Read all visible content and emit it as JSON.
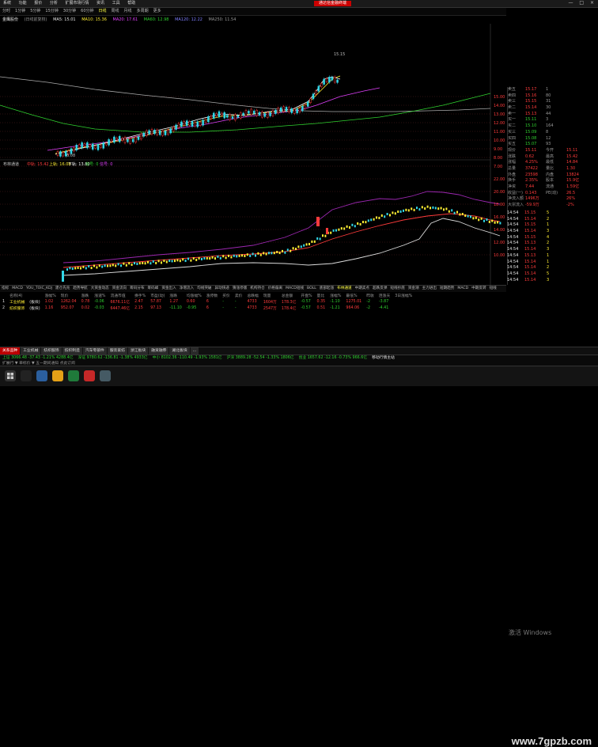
{
  "menu": {
    "items": [
      "系统",
      "功能",
      "报价",
      "分析",
      "扩展市场行情",
      "资讯",
      "工具",
      "帮助"
    ],
    "promo": "通达信金融终端",
    "window_controls": "— □ ×"
  },
  "periods": {
    "items": [
      "分时",
      "1分钟",
      "5分钟",
      "15分钟",
      "30分钟",
      "60分钟",
      "日线",
      "周线",
      "月线",
      "多周期",
      "更多"
    ],
    "selected": 6
  },
  "stock_header": {
    "name": "金鹰股份",
    "period": "(日线前复权)",
    "indicators": [
      "MA5: 15.01",
      "MA10: 15.36",
      "MA20: 17.61",
      "MA60: 12.98",
      "MA120: 12.22",
      "MA250: 11.54"
    ]
  },
  "axis_upper": [
    "15.00",
    "14.00",
    "13.00",
    "12.00",
    "11.00",
    "10.00",
    "9.00",
    "8.00",
    "7.00"
  ],
  "axis_lower": [
    "22.00",
    "20.00",
    "18.00",
    "16.00",
    "14.00",
    "12.00",
    "10.00"
  ],
  "price_marker_hi": "15.15",
  "price_marker_lo": "6.08",
  "lower_panel": {
    "title": "布林通道",
    "params": [
      "中轨: 15.42",
      "上轨: 16.08",
      "下轨: 13.80",
      "信号: 0",
      "信号: 0"
    ]
  },
  "right_panel": {
    "rows": [
      [
        "卖五",
        "15.17",
        "1"
      ],
      [
        "卖四",
        "15.16",
        "80"
      ],
      [
        "卖三",
        "15.15",
        "31"
      ],
      [
        "卖二",
        "15.14",
        "30"
      ],
      [
        "卖一",
        "15.13",
        "44"
      ],
      [
        "买一",
        "15.11",
        "3"
      ],
      [
        "买二",
        "15.10",
        "164"
      ],
      [
        "买三",
        "15.09",
        "8"
      ],
      [
        "买四",
        "15.08",
        "12"
      ],
      [
        "买五",
        "15.07",
        "93"
      ],
      [
        "现价",
        "15.11",
        "今开",
        "15.11"
      ],
      [
        "涨跌",
        "0.62",
        "最高",
        "15.42"
      ],
      [
        "涨幅",
        "4.25%",
        "最低",
        "14.84"
      ],
      [
        "总量",
        "37422",
        "量比",
        "1.30"
      ],
      [
        "外盘",
        "23598",
        "内盘",
        "13824"
      ],
      [
        "换手",
        "2.35%",
        "股本",
        "15.9亿"
      ],
      [
        "净资",
        "7.44",
        "流通",
        "1.59亿"
      ],
      [
        "收益(一)",
        "0.143",
        "PE(动)",
        "26.5"
      ],
      [
        "净流入额",
        "1496万",
        "",
        "26%"
      ],
      [
        "大宗流入",
        "-59.9万",
        "",
        "-2%"
      ]
    ],
    "ticks": [
      [
        "14:54",
        "15.15",
        "5"
      ],
      [
        "14:54",
        "15.14",
        "2"
      ],
      [
        "14:54",
        "15.15",
        "1"
      ],
      [
        "14:54",
        "15.14",
        "3"
      ],
      [
        "14:54",
        "15.15",
        "4"
      ],
      [
        "14:54",
        "15.13",
        "2"
      ],
      [
        "14:54",
        "15.14",
        "3"
      ],
      [
        "14:54",
        "15.13",
        "1"
      ],
      [
        "14:54",
        "15.14",
        "1"
      ],
      [
        "14:54",
        "15.14",
        "2"
      ],
      [
        "14:54",
        "15.14",
        "5"
      ],
      [
        "14:54",
        "15.14",
        "3"
      ],
      [
        "14:54",
        "15.15",
        "3"
      ],
      [
        "14:54",
        "15.14",
        "3"
      ],
      [
        "14:55",
        "15.13",
        "15"
      ],
      [
        "14:55",
        "15.12",
        "15"
      ],
      [
        "14:55",
        "15.11",
        "1"
      ],
      [
        "14:55",
        "15.11",
        "4"
      ],
      [
        "14:55",
        "15.11",
        "3"
      ],
      [
        "14:55",
        "15.12",
        "3"
      ],
      [
        "14:55",
        "15.11",
        "22"
      ],
      [
        "14:55",
        "15.11",
        "5"
      ],
      [
        "14:55",
        "15.11",
        "6"
      ],
      [
        "14:56",
        "15.10",
        "2"
      ],
      [
        "14:56",
        "15.11",
        "8"
      ],
      [
        "14:56",
        "15.11",
        "1"
      ],
      [
        "14:56",
        "15.11",
        "3"
      ],
      [
        "14:56",
        "15.10",
        "4"
      ],
      [
        "14:57",
        "15.11",
        "1"
      ],
      [
        "15:00",
        "15.11",
        "140"
      ]
    ]
  },
  "bottom_tabs": {
    "items": [
      "指标",
      "MACD",
      "YOU_TOIC_KDJ",
      "建仓先兆",
      "趋势导航",
      "大资金动态",
      "资金流向",
      "筹码分布",
      "筹码峰",
      "资金出入",
      "净增流入",
      "均线突破",
      "异动快递",
      "猜涨停版",
      "机构持仓",
      "价格偏离",
      "MACD短线",
      "BOLL",
      "底部起涨",
      "布林通道",
      "中期卖点",
      "超跌反弹",
      "短线抄底",
      "资金潮",
      "主力进出",
      "短期趋势",
      "MACD",
      "中期反转",
      "短线",
      "中线",
      "超跌",
      "趋势",
      "反转",
      "多空",
      "..."
    ],
    "selected": 19
  },
  "grid": {
    "headers": [
      "",
      "名称(4)",
      "",
      "涨幅%",
      "现价",
      "涨跌",
      "涨速%",
      "流通市值",
      "换手%",
      "市盈(动)",
      "涨跌",
      "均涨幅%",
      "涨停数",
      "买价",
      "卖价",
      "总跌幅",
      "现量",
      "总金额",
      "开盘%",
      "量比",
      "涨幅%",
      "最低%",
      "昨收",
      "连涨天",
      "3日涨幅%"
    ],
    "rows": [
      [
        "1",
        "工业机械",
        "(板块)",
        "1.02",
        "1262.04",
        "0.78",
        "-0.06",
        "6676.11亿",
        "2.47",
        "57.87",
        "1.27",
        "0.60",
        "6",
        "-",
        "-",
        "4733",
        "1604万",
        "178.3亿",
        "-0.57",
        "0.35",
        "-1.10",
        "1275.01",
        "-2",
        "-3.87"
      ],
      [
        "2",
        "纺织服饰",
        "(板块)",
        "1.16",
        "952.07",
        "0.02",
        "-0.03",
        "6447.46亿",
        "2.15",
        "97.13",
        "-11.10",
        "-0.95",
        "6",
        "-",
        "-",
        "4733",
        "2547万",
        "178.4亿",
        "-0.57",
        "0.51",
        "-1.21",
        "964.06",
        "-2",
        "-4.41"
      ]
    ]
  },
  "sector_tabs": {
    "items": [
      "关系品种",
      "工业机械",
      "纺织服饰",
      "纺织制造",
      "汽车零部件",
      "服装家纺",
      "浙江板块",
      "融资融券",
      "湖北板块",
      "..."
    ],
    "selected": 0
  },
  "status": {
    "line1": [
      "上证 3066.48 -37.43 -1.21% 4288.4亿",
      "深证 9780.62 -136.81 -1.38% 4933亿",
      "中小 8102.36 -110.49 -1.93% 1581亿",
      "沪深 3889.28 -52.54 -1.33% 1806亿",
      "创业 1657.62 -12.16 -0.73% 966.6亿",
      "移动行情主站"
    ],
    "line2": [
      "扩展行 ▼ 单标价 ▼  五一期间通知  点此订阅"
    ]
  },
  "windows_activate": "激活 Windows",
  "watermark": "www.7gpzb.com"
}
